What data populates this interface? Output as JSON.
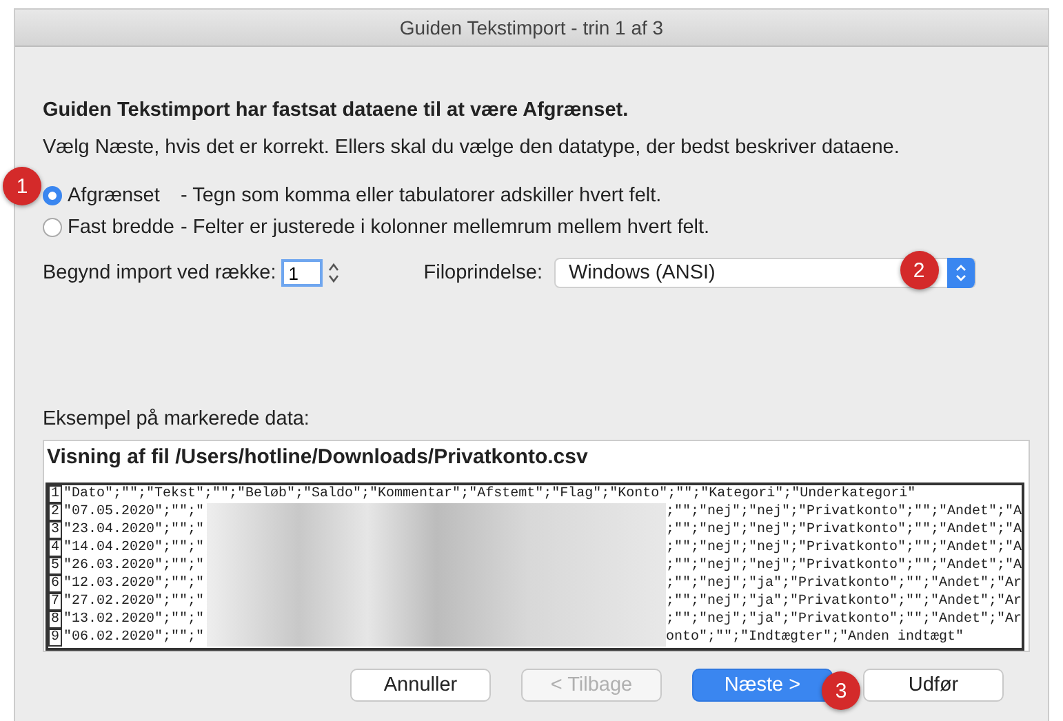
{
  "window": {
    "title": "Guiden Tekstimport - trin 1 af 3"
  },
  "heading": "Guiden Tekstimport har fastsat dataene til at være Afgrænset.",
  "instruction": "Vælg Næste, hvis det er korrekt. Ellers skal du vælge den datatype, der bedst beskriver dataene.",
  "data_types": [
    {
      "label": "Afgrænset",
      "description": "- Tegn som komma eller tabulatorer adskiller hvert felt.",
      "selected": true
    },
    {
      "label": "Fast bredde",
      "description": "- Felter er justerede i kolonner mellemrum mellem hvert felt.",
      "selected": false
    }
  ],
  "start_row": {
    "label": "Begynd import ved række:",
    "value": "1"
  },
  "file_origin": {
    "label": "Filoprindelse:",
    "value": "Windows (ANSI)"
  },
  "preview": {
    "label": "Eksempel på markerede data:",
    "file_title": "Visning af fil /Users/hotline/Downloads/Privatkonto.csv",
    "rows": [
      {
        "number": "1",
        "kind": "full",
        "text": "\"Dato\";\"\";\"Tekst\";\"\";\"Beløb\";\"Saldo\";\"Kommentar\";\"Afstemt\";\"Flag\";\"Konto\";\"\";\"Kategori\";\"Underkategori\""
      },
      {
        "number": "2",
        "kind": "blurred",
        "start": "\"07.05.2020\";\"\";\"",
        "end": ";\"\";\"nej\";\"nej\";\"Privatkonto\";\"\";\"Andet\";\"A"
      },
      {
        "number": "3",
        "kind": "blurred",
        "start": "\"23.04.2020\";\"\";\"",
        "end": ";\"\";\"nej\";\"nej\";\"Privatkonto\";\"\";\"Andet\";\"A"
      },
      {
        "number": "4",
        "kind": "blurred",
        "start": "\"14.04.2020\";\"\";\"",
        "end": ";\"\";\"nej\";\"nej\";\"Privatkonto\";\"\";\"Andet\";\"A"
      },
      {
        "number": "5",
        "kind": "blurred",
        "start": "\"26.03.2020\";\"\";\"",
        "end": ";\"\";\"nej\";\"nej\";\"Privatkonto\";\"\";\"Andet\";\"A"
      },
      {
        "number": "6",
        "kind": "blurred",
        "start": "\"12.03.2020\";\"\";\"",
        "end": ";\"\";\"nej\";\"ja\";\"Privatkonto\";\"\";\"Andet\";\"Ar"
      },
      {
        "number": "7",
        "kind": "blurred",
        "start": "\"27.02.2020\";\"\";\"",
        "end": ";\"\";\"nej\";\"ja\";\"Privatkonto\";\"\";\"Andet\";\"Ar"
      },
      {
        "number": "8",
        "kind": "blurred",
        "start": "\"13.02.2020\";\"\";\"",
        "end": ";\"\";\"nej\";\"ja\";\"Privatkonto\";\"\";\"Andet\";\"Ar"
      },
      {
        "number": "9",
        "kind": "blurred",
        "start": "\"06.02.2020\";\"\";\"",
        "end": "onto\";\"\";\"Indtægter\";\"Anden indtægt\""
      }
    ]
  },
  "buttons": [
    {
      "label": "Annuller",
      "kind": "normal",
      "disabled": false
    },
    {
      "label": "< Tilbage",
      "kind": "normal",
      "disabled": true
    },
    {
      "label": "Næste >",
      "kind": "default",
      "disabled": false
    },
    {
      "label": "Udfør",
      "kind": "normal",
      "disabled": false
    }
  ],
  "annotations": [
    "1",
    "2",
    "3"
  ]
}
